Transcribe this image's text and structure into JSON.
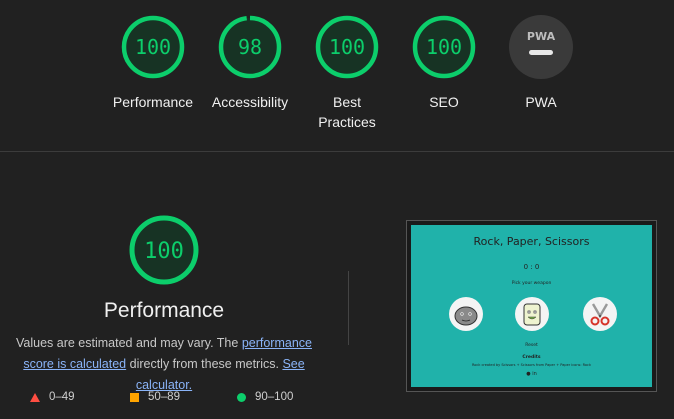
{
  "colors": {
    "pass": "#0cce6b",
    "average": "#ffa400",
    "fail": "#ff4e42",
    "pwa": "#e0e0e0",
    "link": "#8ab4f8"
  },
  "gauges": [
    {
      "label": "Performance",
      "score": "100",
      "fraction": 1.0
    },
    {
      "label": "Accessibility",
      "score": "98",
      "fraction": 0.98
    },
    {
      "label": "Best Practices",
      "score": "100",
      "fraction": 1.0
    },
    {
      "label": "SEO",
      "score": "100",
      "fraction": 1.0
    },
    {
      "label": "PWA",
      "badge": "PWA"
    }
  ],
  "performance": {
    "score": "100",
    "fraction": 1.0,
    "title": "Performance",
    "desc_prefix": "Values are estimated and may vary. The ",
    "link1": "performance score is calculated",
    "desc_middle": " directly from these metrics. ",
    "link2": "See calculator."
  },
  "legend": [
    {
      "icon": "fail-triangle-icon",
      "range": "0–49"
    },
    {
      "icon": "average-square-icon",
      "range": "50–89"
    },
    {
      "icon": "pass-circle-icon",
      "range": "90–100"
    }
  ],
  "screenshot": {
    "title": "Rock, Paper, Scissors",
    "score": "0 : 0",
    "pick": "Pick your weapon",
    "weapons": [
      "rock-icon",
      "paper-icon",
      "scissors-icon"
    ],
    "reset": "Reset",
    "credits_heading": "Credits",
    "credits_text": "Rock created by Scissors + Scissors from Paper + Paper icons: Rock",
    "social_icons": [
      "github-icon",
      "linkedin-icon"
    ]
  }
}
